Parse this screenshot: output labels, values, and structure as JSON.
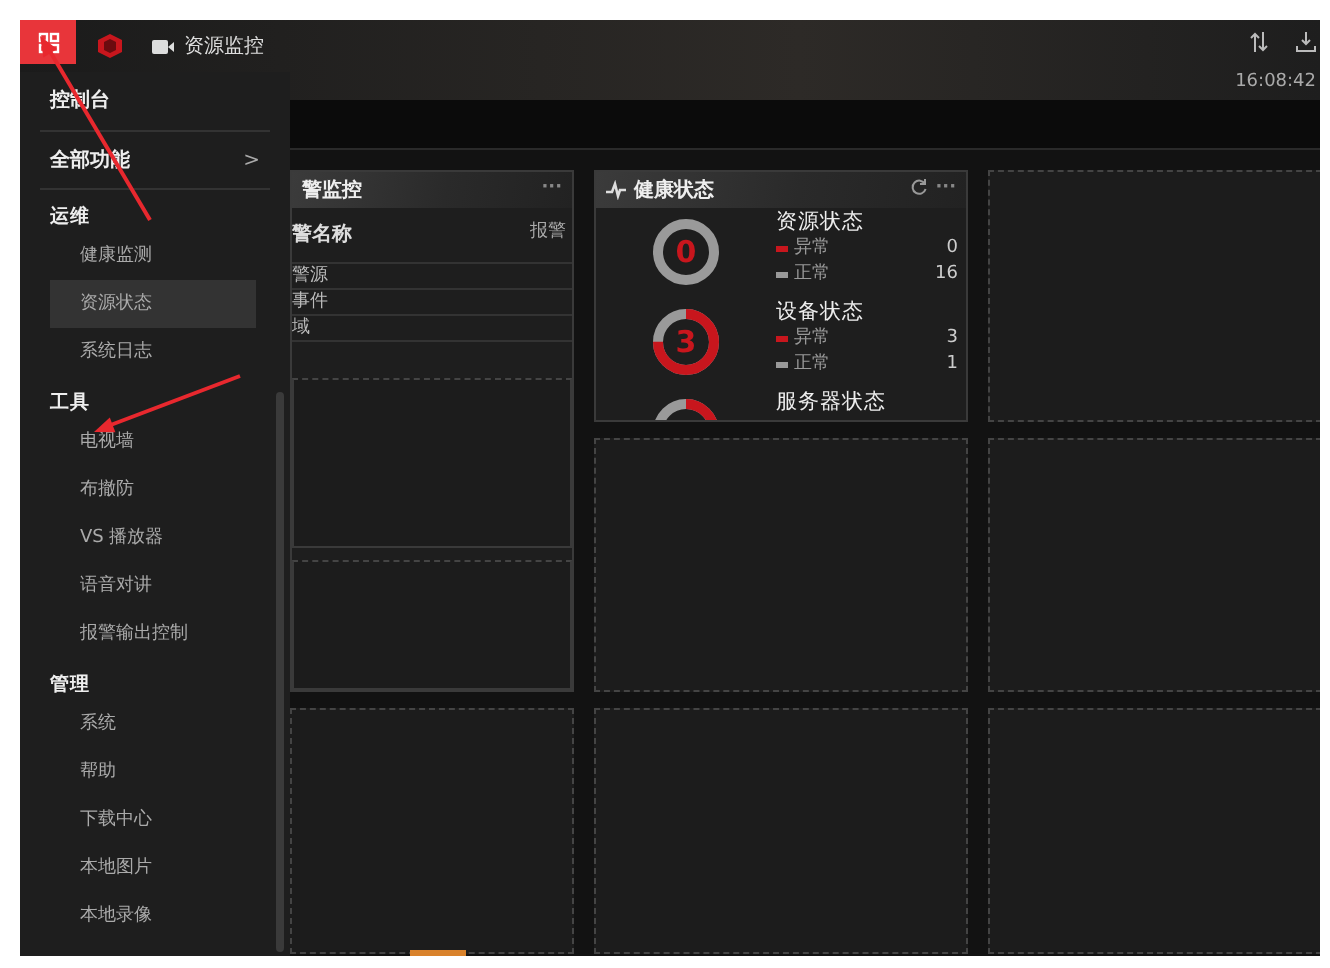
{
  "topbar": {
    "title": "资源监控",
    "time": "16:08:42"
  },
  "sidebar": {
    "console": "控制台",
    "all_functions": {
      "label": "全部功能",
      "chevron": ">"
    },
    "groups": [
      {
        "title": "运维",
        "items": [
          {
            "label": "健康监测",
            "selected": false
          },
          {
            "label": "资源状态",
            "selected": true
          },
          {
            "label": "系统日志",
            "selected": false
          }
        ]
      },
      {
        "title": "工具",
        "items": [
          {
            "label": "电视墙",
            "selected": false
          },
          {
            "label": "布撤防",
            "selected": false
          },
          {
            "label": "VS 播放器",
            "selected": false
          },
          {
            "label": "语音对讲",
            "selected": false
          },
          {
            "label": "报警输出控制",
            "selected": false
          }
        ]
      },
      {
        "title": "管理",
        "items": [
          {
            "label": "系统",
            "selected": false
          },
          {
            "label": "帮助",
            "selected": false
          },
          {
            "label": "下载中心",
            "selected": false
          },
          {
            "label": "本地图片",
            "selected": false
          },
          {
            "label": "本地录像",
            "selected": false
          }
        ]
      }
    ]
  },
  "alarm_panel": {
    "title": "警监控",
    "more": "···",
    "column_1": "警名称",
    "column_2": "报警",
    "rows": [
      "警源",
      "事件",
      "域"
    ]
  },
  "health_panel": {
    "title": "健康状态",
    "more": "···",
    "sections": [
      {
        "title": "资源状态",
        "value": "0",
        "abnormal": {
          "label": "异常",
          "count": "0"
        },
        "normal": {
          "label": "正常",
          "count": "16"
        }
      },
      {
        "title": "设备状态",
        "value": "3",
        "abnormal": {
          "label": "异常",
          "count": "3"
        },
        "normal": {
          "label": "正常",
          "count": "1"
        }
      },
      {
        "title": "服务器状态"
      }
    ]
  }
}
